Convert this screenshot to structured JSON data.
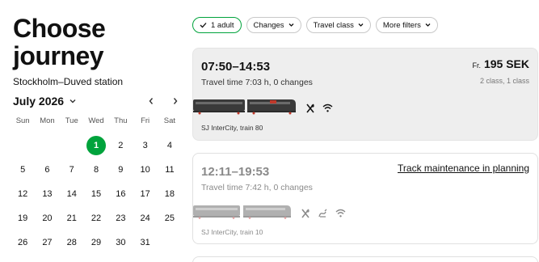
{
  "page": {
    "title_line1": "Choose",
    "title_line2": "journey",
    "route": "Stockholm–Duved station"
  },
  "calendar": {
    "month_label": "July 2026",
    "weekdays": [
      "Sun",
      "Mon",
      "Tue",
      "Wed",
      "Thu",
      "Fri",
      "Sat"
    ],
    "leading_blank_days": 3,
    "days": [
      "1",
      "2",
      "3",
      "4",
      "5",
      "6",
      "7",
      "8",
      "9",
      "10",
      "11",
      "12",
      "13",
      "14",
      "15",
      "16",
      "17",
      "18",
      "19",
      "20",
      "21",
      "22",
      "23",
      "24",
      "25",
      "26",
      "27",
      "28",
      "29",
      "30",
      "31"
    ],
    "selected_day": "1",
    "icons": {
      "month_toggle": "chevron-down-icon",
      "prev": "chevron-left-icon",
      "next": "chevron-right-icon"
    }
  },
  "filters": [
    {
      "label": "1 adult",
      "active": true,
      "icon": "check-icon"
    },
    {
      "label": "Changes",
      "active": false,
      "icon": "chevron-down-icon"
    },
    {
      "label": "Travel class",
      "active": false,
      "icon": "chevron-down-icon"
    },
    {
      "label": "More filters",
      "active": false,
      "icon": "chevron-down-icon"
    }
  ],
  "journeys": [
    {
      "times": "07:50–14:53",
      "travel_info": "Travel time 7:03 h, 0 changes",
      "price_prefix": "Fr.",
      "price": "195 SEK",
      "classes": "2 class, 1 class",
      "amenities": [
        "restaurant-icon",
        "wifi-icon"
      ],
      "train_name": "SJ InterCity, train 80",
      "available": true
    },
    {
      "times": "12:11–19:53",
      "travel_info": "Travel time 7:42 h, 0 changes",
      "notice": "Track maintenance in planning",
      "amenities": [
        "restaurant-icon",
        "pet-icon",
        "wifi-icon"
      ],
      "train_name": "SJ InterCity, train 10",
      "available": false
    }
  ],
  "colors": {
    "accent": "#00a33c",
    "selected_card_bg": "#eeeeee",
    "muted_text": "#8a8a8a",
    "train_dark": "#3a3a3a",
    "train_light": "#b0b0b0",
    "train_red": "#c0392b"
  }
}
